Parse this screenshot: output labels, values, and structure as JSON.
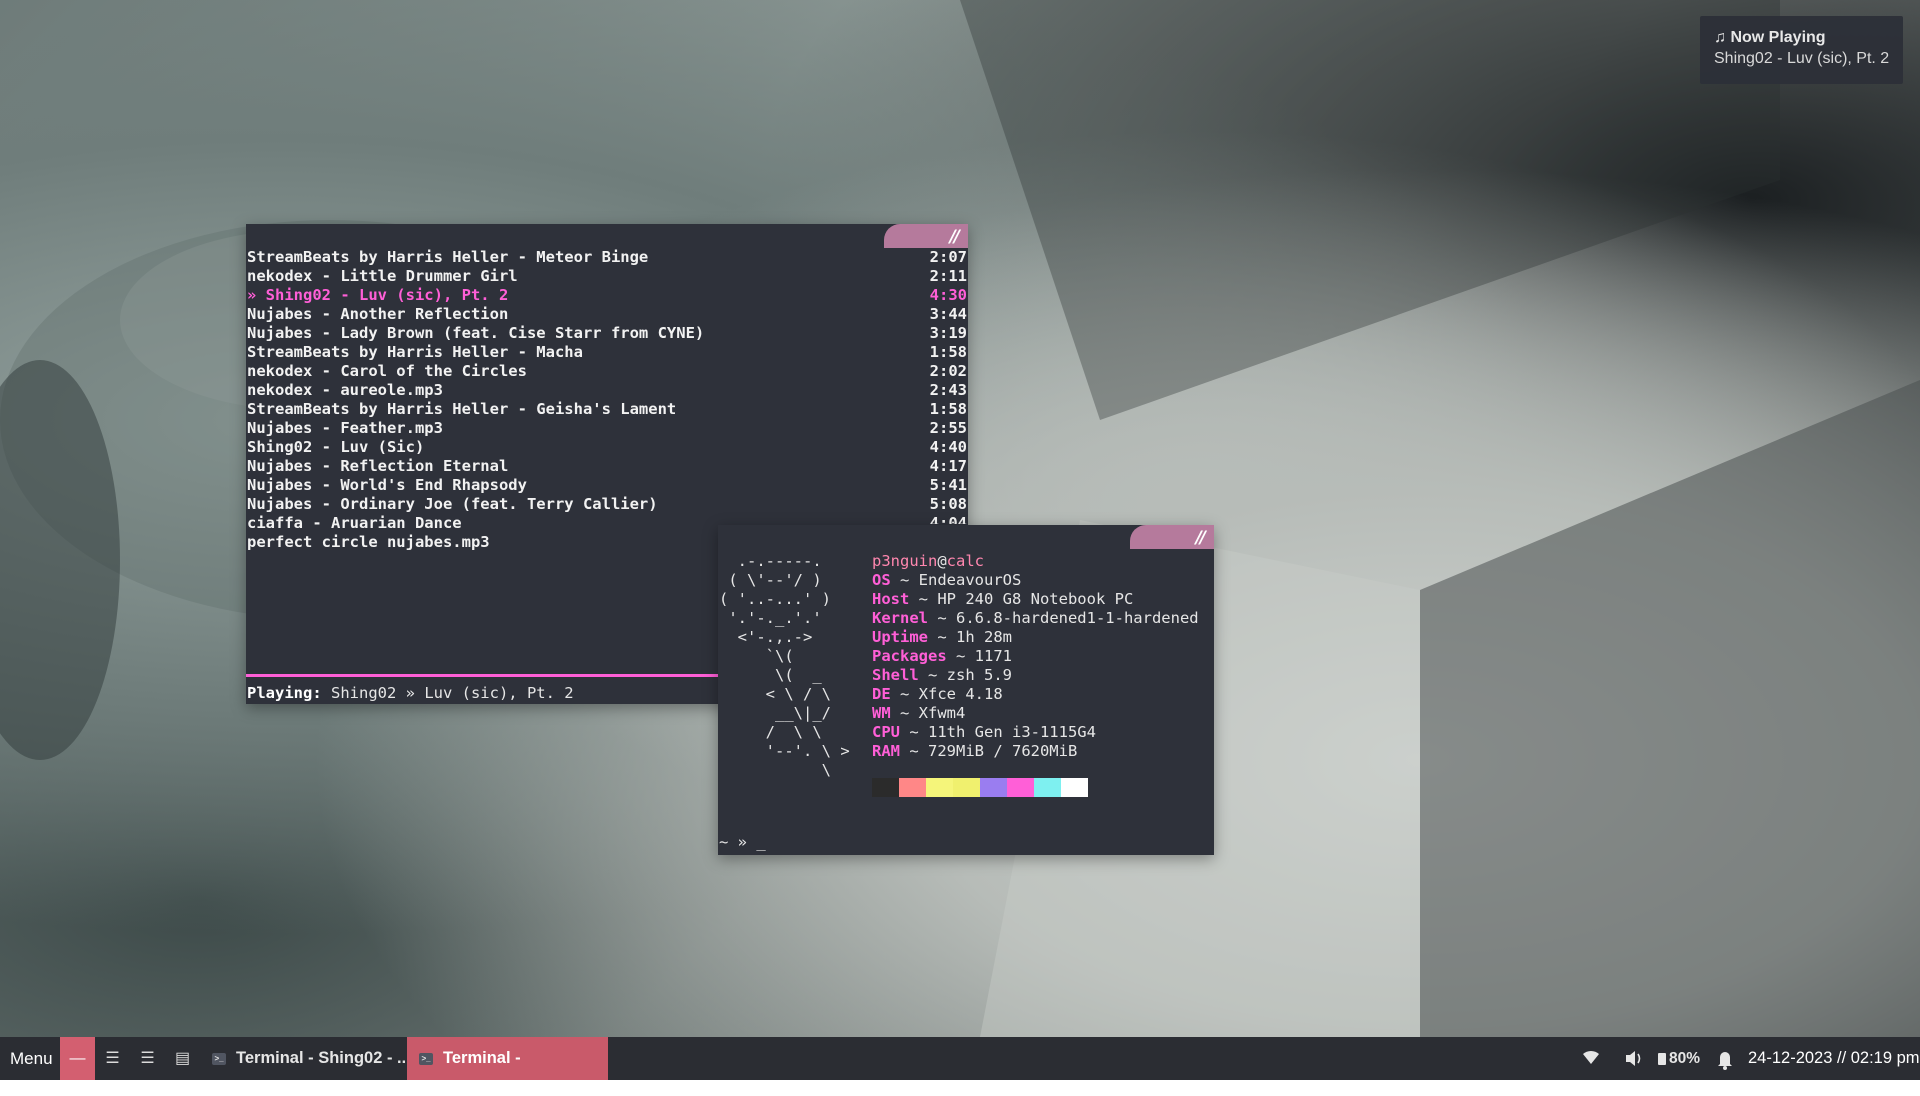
{
  "notification": {
    "title": "♫ Now Playing",
    "body": "Shing02 - Luv (sic), Pt. 2"
  },
  "player": {
    "tracks": [
      {
        "title": "StreamBeats by Harris Heller - Meteor Binge",
        "duration": "2:07"
      },
      {
        "title": "nekodex - Little Drummer Girl",
        "duration": "2:11"
      },
      {
        "title": "» Shing02 - Luv (sic), Pt. 2",
        "duration": "4:30"
      },
      {
        "title": "Nujabes - Another Reflection",
        "duration": "3:44"
      },
      {
        "title": "Nujabes - Lady Brown (feat. Cise Starr from CYNE)",
        "duration": "3:19"
      },
      {
        "title": "StreamBeats by Harris Heller - Macha",
        "duration": "1:58"
      },
      {
        "title": "nekodex - Carol of the Circles",
        "duration": "2:02"
      },
      {
        "title": "nekodex - aureole.mp3",
        "duration": "2:43"
      },
      {
        "title": "StreamBeats by Harris Heller - Geisha's Lament",
        "duration": "1:58"
      },
      {
        "title": "Nujabes - Feather.mp3",
        "duration": "2:55"
      },
      {
        "title": "Shing02 - Luv (Sic)",
        "duration": "4:40"
      },
      {
        "title": "Nujabes - Reflection Eternal",
        "duration": "4:17"
      },
      {
        "title": "Nujabes - World's End Rhapsody",
        "duration": "5:41"
      },
      {
        "title": "Nujabes - Ordinary Joe (feat. Terry Callier)",
        "duration": "5:08"
      },
      {
        "title": "ciaffa - Aruarian Dance",
        "duration": "4:04"
      },
      {
        "title": "perfect circle nujabes.mp3",
        "duration": ""
      }
    ],
    "playing_label": "Playing:",
    "playing_value": "Shing02 » Luv (sic), Pt. 2",
    "accent": "#ff5fd7"
  },
  "fetch": {
    "ascii_art": "  .-.-----.\n ( \\'--'/ )\n( '..-...' )\n '.'-._.'.'\n  <'-.,.->\n     `\\(\n      \\(  _\n     < \\ / \\\n      __\\|_/\n     /  \\ \\\n     '--'. \\ >\n           \\",
    "user": "p3nguin",
    "at": "@",
    "host": "calc",
    "info": [
      {
        "key": "OS",
        "value": " ~ EndeavourOS"
      },
      {
        "key": "Host",
        "value": " ~ HP 240 G8 Notebook PC"
      },
      {
        "key": "Kernel",
        "value": " ~ 6.6.8-hardened1-1-hardened"
      },
      {
        "key": "Uptime",
        "value": " ~ 1h 28m"
      },
      {
        "key": "Packages",
        "value": " ~ 1171"
      },
      {
        "key": "Shell",
        "value": " ~ zsh 5.9"
      },
      {
        "key": "DE",
        "value": " ~ Xfce 4.18"
      },
      {
        "key": "WM",
        "value": " ~ Xfwm4"
      },
      {
        "key": "CPU",
        "value": " ~ 11th Gen i3-1115G4"
      },
      {
        "key": "RAM",
        "value": " ~ 729MiB / 7620MiB"
      }
    ],
    "palette": [
      "#2b2b2b",
      "#ff8787",
      "#f5f57a",
      "#f0f06e",
      "#9a7df0",
      "#ff5fd7",
      "#7ef0f0",
      "#ffffff"
    ],
    "prompt": "~ » _"
  },
  "taskbar": {
    "menu_label": "Menu",
    "workspaces": [
      "—",
      "☰",
      "☰",
      "▤"
    ],
    "tasks": [
      {
        "label": "Terminal - Shing02 - ..."
      },
      {
        "label": "Terminal -"
      }
    ],
    "icons": {
      "wifi": "wifi-icon",
      "volume": "volume-icon",
      "battery": "battery-icon",
      "bell": "bell-icon"
    },
    "battery_label": "80%",
    "clock": "24-12-2023 // 02:19 pm"
  }
}
